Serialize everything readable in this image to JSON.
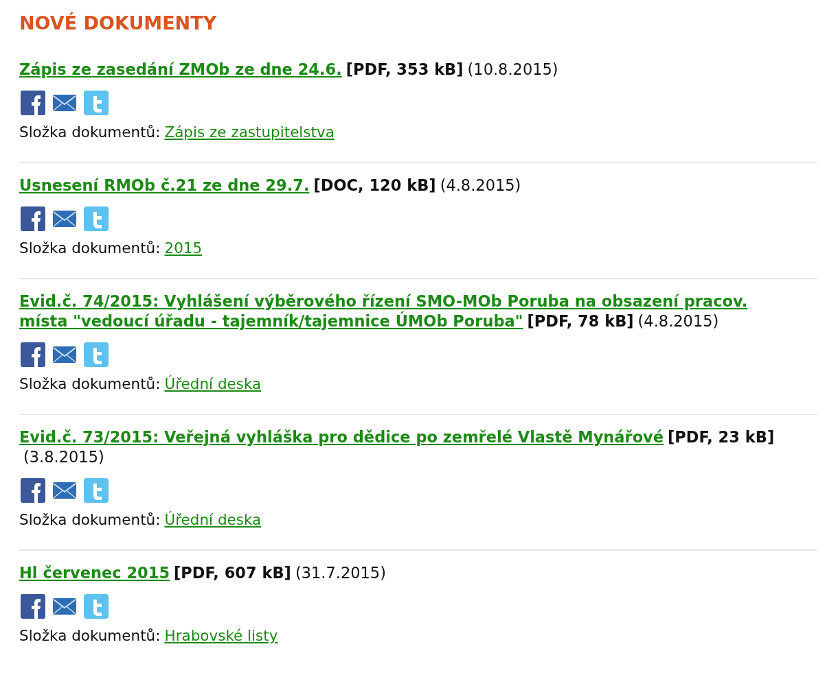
{
  "heading": "NOVÉ DOKUMENTY",
  "documents": [
    {
      "title": "Zápis ze zasedání ZMOb ze dne 24.6.",
      "file_info": "[PDF, 353 kB]",
      "date": "(10.8.2015)",
      "folder_label": "Složka dokumentů:",
      "folder": "Zápis ze zastupitelstva"
    },
    {
      "title": "Usnesení RMOb č.21 ze dne 29.7.",
      "file_info": "[DOC, 120 kB]",
      "date": "(4.8.2015)",
      "folder_label": "Složka dokumentů:",
      "folder": "2015"
    },
    {
      "title": "Evid.č. 74/2015: Vyhlášení výběrového řízení SMO-MOb Poruba na obsazení pracov. místa \"vedoucí úřadu - tajemník/tajemnice ÚMOb Poruba\"",
      "file_info": "[PDF, 78 kB]",
      "date": "(4.8.2015)",
      "folder_label": "Složka dokumentů:",
      "folder": "Úřední deska"
    },
    {
      "title": "Evid.č. 73/2015: Veřejná vyhláška pro dědice po zemřelé Vlastě Mynářové",
      "file_info": "[PDF, 23 kB]",
      "date": "(3.8.2015)",
      "folder_label": "Složka dokumentů:",
      "folder": "Úřední deska"
    },
    {
      "title": "Hl červenec 2015",
      "file_info": "[PDF, 607 kB]",
      "date": "(31.7.2015)",
      "folder_label": "Složka dokumentů:",
      "folder": "Hrabovské listy"
    }
  ]
}
